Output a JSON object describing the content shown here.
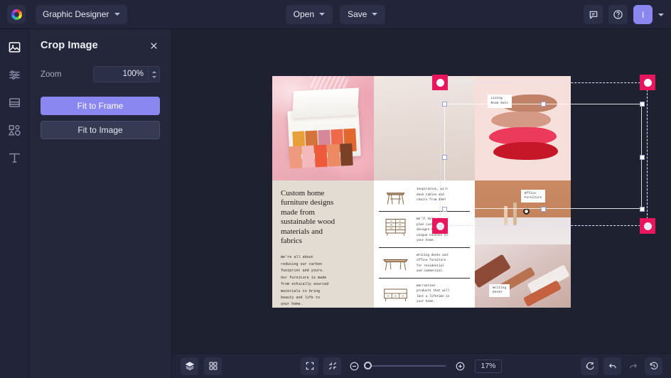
{
  "app": {
    "logo_icon": "color-wheel-logo",
    "document_name": "Graphic Designer",
    "open_label": "Open",
    "save_label": "Save",
    "comments_icon": "comment-icon",
    "help_icon": "help-circle-icon",
    "avatar_initial": "I",
    "accent_color": "#8b87f0",
    "handle_color": "#e8175d",
    "chrome_color": "#22253a",
    "canvas_color": "#1e2130"
  },
  "rail": {
    "items": [
      {
        "name": "image-tool",
        "icon": "image-icon",
        "active": true
      },
      {
        "name": "adjust-tool",
        "icon": "sliders-icon",
        "active": false
      },
      {
        "name": "layout-tool",
        "icon": "layout-icon",
        "active": false
      },
      {
        "name": "shapes-tool",
        "icon": "shapes-icon",
        "active": false
      },
      {
        "name": "text-tool",
        "icon": "text-icon",
        "active": false
      }
    ]
  },
  "panel": {
    "title": "Crop Image",
    "close_icon": "close-icon",
    "zoom_label": "Zoom",
    "zoom_value": "100%",
    "fit_to_frame_label": "Fit to Frame",
    "fit_to_image_label": "Fit to Image"
  },
  "bottombar": {
    "layers_icon": "layers-icon",
    "grid_icon": "grid-icon",
    "fit_screen_icon": "fit-screen-icon",
    "collapse_icon": "collapse-icon",
    "zoom_out_icon": "zoom-out-icon",
    "zoom_in_icon": "zoom-in-icon",
    "zoom_value": "17%",
    "reset_icon": "reset-icon",
    "undo_icon": "undo-icon",
    "redo_icon": "redo-icon",
    "history_icon": "history-icon"
  },
  "artboard": {
    "tags": {
      "living_room": "Living\nRoom Sets",
      "office": "Office\nFurniture",
      "writing": "Writing\nDesks"
    },
    "headline": "Custom home\nfurniture designs\nmade from\nsustainable wood\nmaterials and\nfabrics",
    "body": "We're all about\nreducing our carbon\nfootprint and yours.\nOur furniture is made\nfrom ethically sourced\nmaterials to bring\nbeauty and life to\nyour home.",
    "list": [
      {
        "sketch": "stool-sketch",
        "text": "Inspiration, with\ndesk tables and\nchairs from $400"
      },
      {
        "sketch": "dresser-sketch",
        "text": "We'll help you\nplan custom\ndesigns to add\nunique touches to\nyour home."
      },
      {
        "sketch": "desk-sketch",
        "text": "Writing desks and\noffice furniture\nfor residential\nand commercial."
      },
      {
        "sketch": "sideboard-sketch",
        "text": "Warrantied\nproducts that will\nlast a lifetime in\nyour home."
      }
    ],
    "swatch_colors": [
      "#c08268",
      "#d59a86",
      "#ec3a5c",
      "#c61728"
    ],
    "pan_colors_top": [
      "#e8a13a",
      "#d4743a",
      "#d6889a",
      "#ee6a4a",
      "#e2672f"
    ],
    "pan_colors_bottom": [
      "#ef9a7e",
      "#f3b9bb",
      "#ef5a3a",
      "#ec8a62",
      "#7a4126"
    ]
  }
}
